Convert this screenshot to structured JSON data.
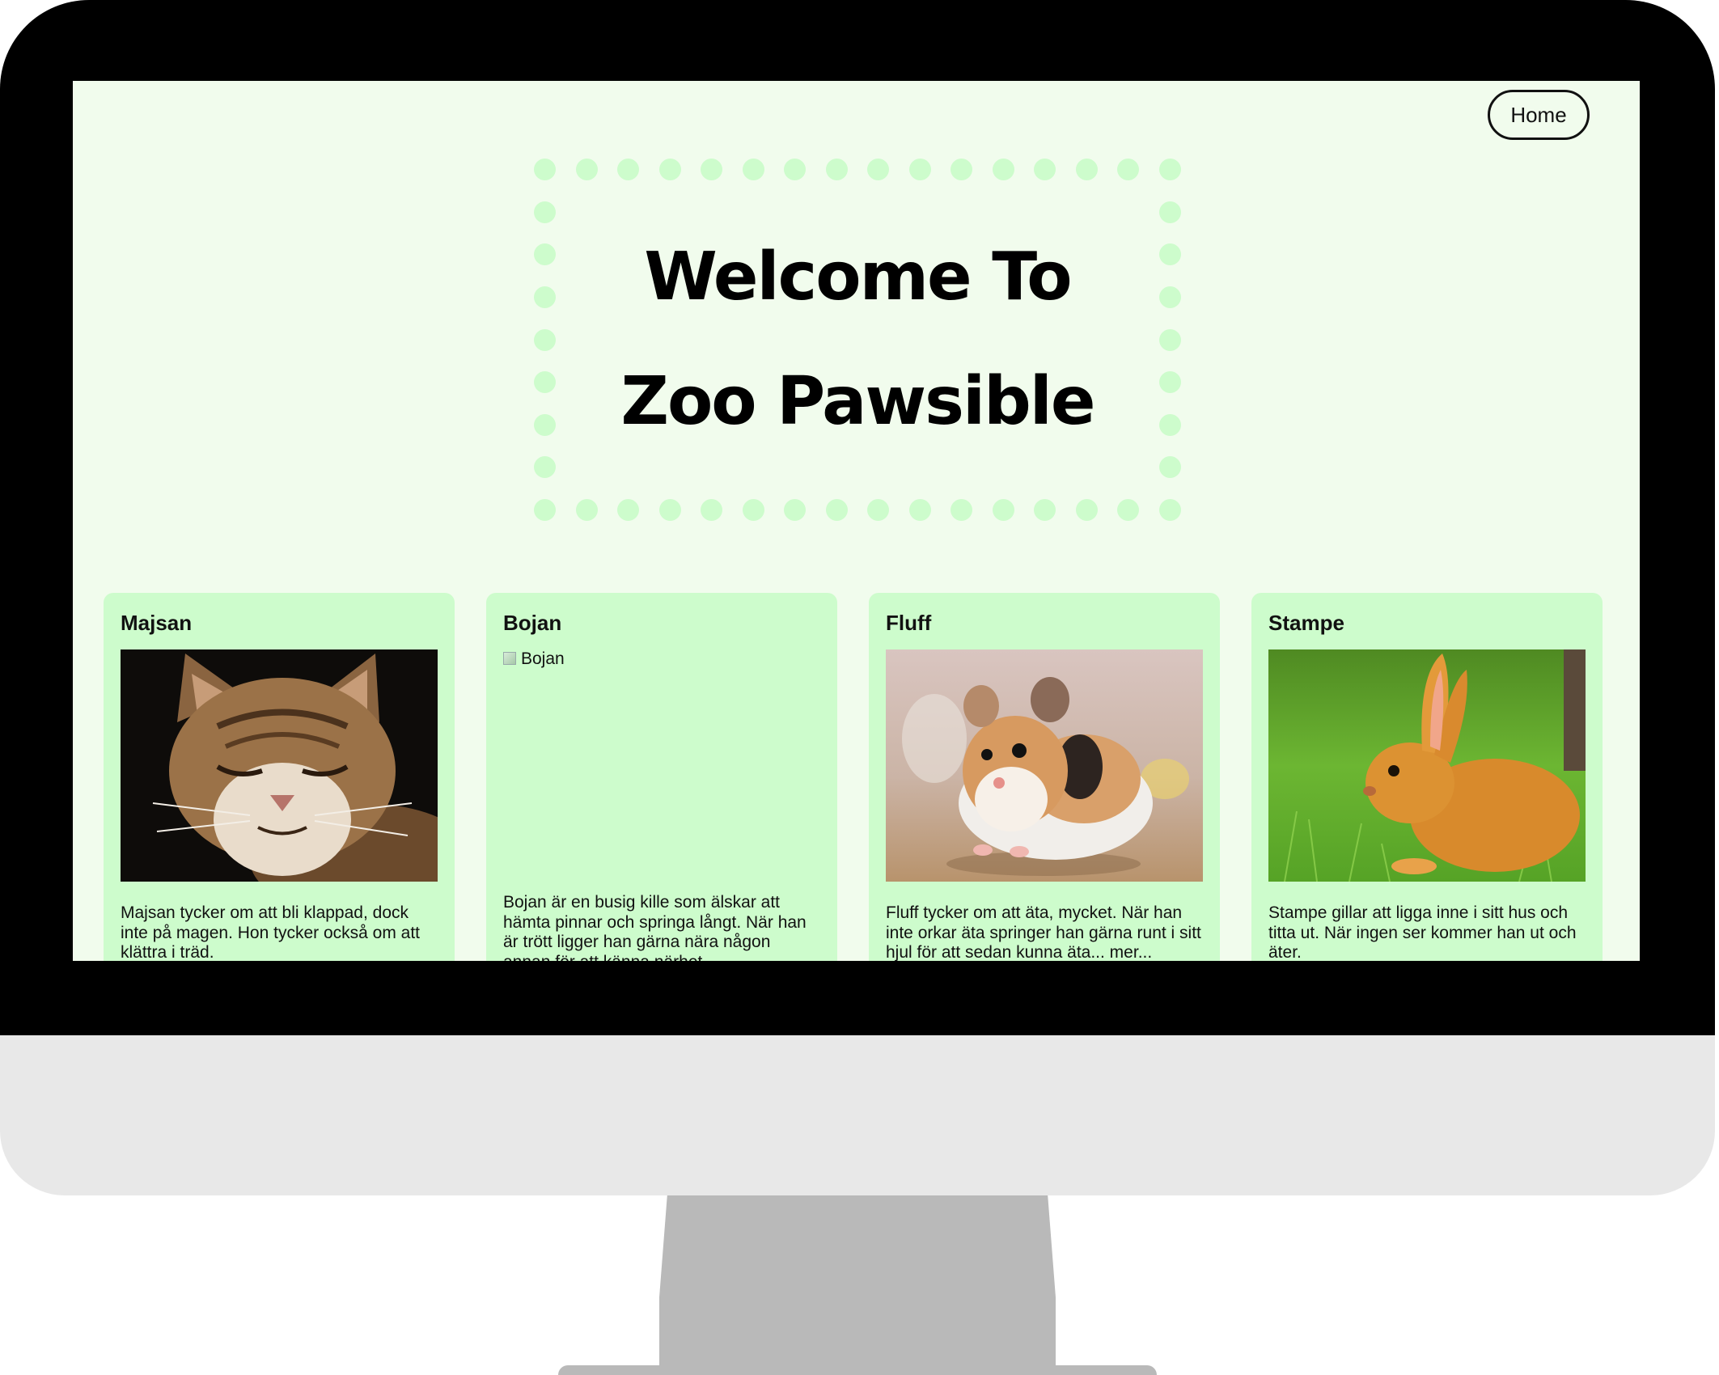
{
  "nav": {
    "home_label": "Home"
  },
  "hero": {
    "line1": "Welcome To",
    "line2": "Zoo Pawsible"
  },
  "colors": {
    "screen_bg": "#f1fced",
    "card_bg": "#cdfccc",
    "dot": "#cdfccc"
  },
  "animals": [
    {
      "name": "Majsan",
      "image_alt": "Majsan",
      "image_kind": "cat",
      "description": "Majsan tycker om att bli klappad, dock inte på magen. Hon tycker också om att klättra i träd."
    },
    {
      "name": "Bojan",
      "image_alt": "Bojan",
      "image_kind": "broken",
      "description": "Bojan är en busig kille som älskar att hämta pinnar och springa långt. När han är trött ligger han gärna nära någon annan för att känna närhet."
    },
    {
      "name": "Fluff",
      "image_alt": "Fluff",
      "image_kind": "hamster",
      "description": "Fluff tycker om att äta, mycket. När han inte orkar äta springer han gärna runt i sitt hjul för att sedan kunna äta... mer..."
    },
    {
      "name": "Stampe",
      "image_alt": "Stampe",
      "image_kind": "rabbit",
      "description": "Stampe gillar att ligga inne i sitt hus och titta ut. När ingen ser kommer han ut och äter."
    }
  ]
}
